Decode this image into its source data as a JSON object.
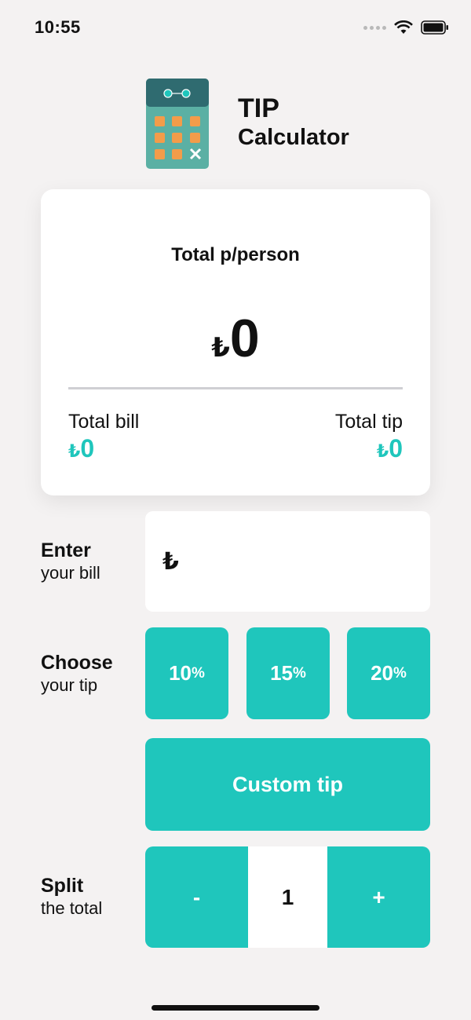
{
  "status_bar": {
    "time": "10:55"
  },
  "header": {
    "title_line1": "TIP",
    "title_line2": "Calculator"
  },
  "summary": {
    "label": "Total p/person",
    "currency": "₺",
    "per_person": "0",
    "bill_label": "Total bill",
    "bill_value": "0",
    "tip_label": "Total tip",
    "tip_value": "0"
  },
  "bill": {
    "title": "Enter",
    "subtitle": "your bill",
    "currency": "₺",
    "value": ""
  },
  "tip": {
    "title": "Choose",
    "subtitle": "your tip",
    "options": [
      {
        "value": "10",
        "unit": "%"
      },
      {
        "value": "15",
        "unit": "%"
      },
      {
        "value": "20",
        "unit": "%"
      }
    ],
    "custom_label": "Custom tip"
  },
  "split": {
    "title": "Split",
    "subtitle": "the total",
    "minus": "-",
    "count": "1",
    "plus": "+"
  },
  "colors": {
    "accent": "#1fc6bc",
    "background": "#f4f2f2",
    "card": "#ffffff"
  },
  "icons": [
    "cellular-signal-icon",
    "wifi-icon",
    "battery-icon",
    "calculator-logo-icon"
  ]
}
